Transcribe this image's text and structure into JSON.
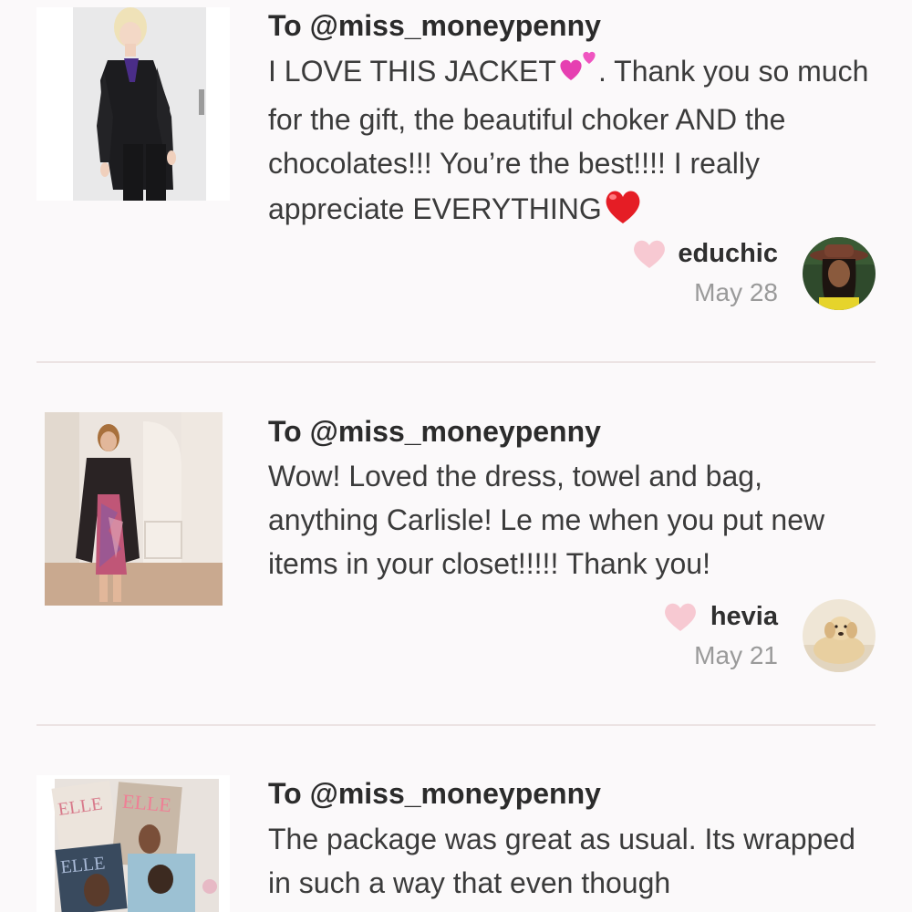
{
  "feed": {
    "items": [
      {
        "recipient": "To @miss_moneypenny",
        "message_parts": [
          "I LOVE THIS JACKET",
          ". Thank you so much for the gift, the beautiful choker AND the chocolates!!! You’re the best!!!! I really appreciate EVERYTHING"
        ],
        "emojis": [
          "sparkling-hearts-emoji",
          "red-heart-emoji"
        ],
        "username": "educhic",
        "date": "May 28",
        "like_icon": "heart-icon"
      },
      {
        "recipient": "To @miss_moneypenny",
        "message": "Wow! Loved the dress, towel and bag, anything Carlisle! Le me when you put new items in your closet!!!!! Thank you!",
        "username": "hevia",
        "date": "May 21",
        "like_icon": "heart-icon"
      },
      {
        "recipient": "To @miss_moneypenny",
        "message": "The package was great as usual. Its wrapped in such a way that even though"
      }
    ]
  },
  "colors": {
    "background": "#fbf9fa",
    "like_heart": "#f7c9d2",
    "divider": "#ece3e3",
    "date_text": "#9a9a9a"
  }
}
